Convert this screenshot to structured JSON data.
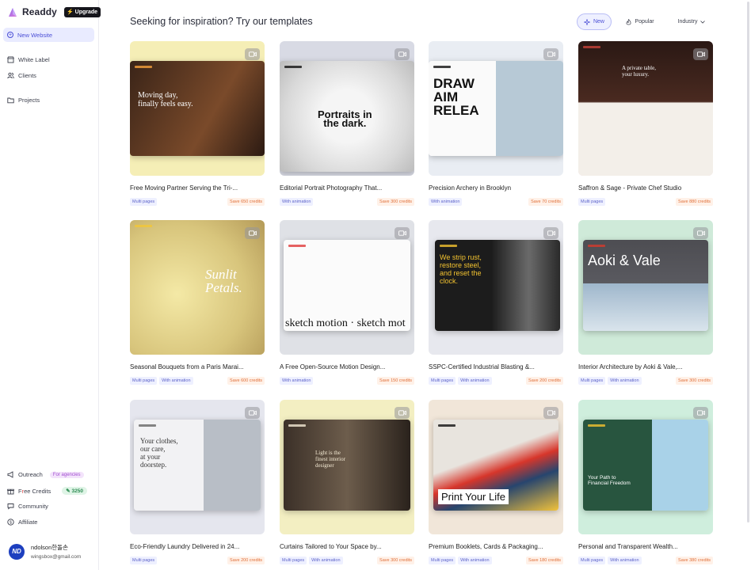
{
  "app": {
    "brand": "Readdy",
    "upgrade_label": "Upgrade"
  },
  "sidebar": {
    "new_website": "New Website",
    "nav": {
      "white_label": "White Label",
      "clients": "Clients",
      "projects": "Projects"
    },
    "bottom": {
      "outreach": "Outreach",
      "outreach_badge": "For agencies",
      "credits_prefix": "F",
      "credits_r": "r",
      "credits_suffix": "ee Credits",
      "credits_value": "3250",
      "community": "Community",
      "affiliate": "Affiliate"
    },
    "user": {
      "initials": "ND",
      "name": "ndolson한돌손",
      "email": "wingsbox@gmail.com"
    }
  },
  "header": {
    "title": "Seeking for inspiration? Try our templates",
    "filters": {
      "new": "New",
      "popular": "Popular",
      "industry": "Industry"
    }
  },
  "templates": [
    {
      "title": "Free Moving Partner Serving the Tri-...",
      "tags": [
        "Multi pages"
      ],
      "credits": "Save 650 credits",
      "bg": "#f5eeb6",
      "screen_text": [
        "Moving day,",
        "finally feels easy."
      ]
    },
    {
      "title": "Editorial Portrait Photography That...",
      "tags": [
        "With animation"
      ],
      "credits": "Save 300 credits",
      "bg": "#d8dae4",
      "screen_text": [
        "Portraits in",
        "the dark."
      ]
    },
    {
      "title": "Precision Archery in Brooklyn",
      "tags": [
        "With animation"
      ],
      "credits": "Save 70 credits",
      "bg": "#e9edf3",
      "screen_text": [
        "DRAW",
        "AIM",
        "RELEA"
      ]
    },
    {
      "title": "Saffron & Sage - Private Chef Studio",
      "tags": [
        "Multi pages"
      ],
      "credits": "Save 880 credits",
      "bg": "#f2d3dc",
      "screen_text": [
        "A private table,",
        "your luxury."
      ]
    },
    {
      "title": "Seasonal Bouquets from a Paris Marai...",
      "tags": [
        "Multi pages",
        "With animation"
      ],
      "credits": "Save 600 credits",
      "bg": "#f7efb8",
      "screen_text": [
        "Sunlit",
        "Petals."
      ]
    },
    {
      "title": "A Free Open-Source Motion Design...",
      "tags": [
        "With animation"
      ],
      "credits": "Save 150 credits",
      "bg": "#dfe1e6",
      "screen_text": [
        "sketch motion · sketch mot"
      ]
    },
    {
      "title": "SSPC-Certified Industrial Blasting &...",
      "tags": [
        "Multi pages",
        "With animation"
      ],
      "credits": "Save 200 credits",
      "bg": "#e7e8ee",
      "screen_text": [
        "We strip rust,",
        "restore steel,",
        "and reset the",
        "clock."
      ]
    },
    {
      "title": "Interior Architecture by Aoki & Vale,...",
      "tags": [
        "Multi pages",
        "With animation"
      ],
      "credits": "Save 300 credits",
      "bg": "#cfead9",
      "screen_text": [
        "Aoki & Vale"
      ]
    },
    {
      "title": "Eco-Friendly Laundry Delivered in 24...",
      "tags": [
        "Multi pages"
      ],
      "credits": "Save 200 credits",
      "bg": "#e5e6ee",
      "screen_text": [
        "Your clothes,",
        "our care,",
        "at your",
        "doorstep."
      ]
    },
    {
      "title": "Curtains Tailored to Your Space by...",
      "tags": [
        "Multi pages",
        "With animation"
      ],
      "credits": "Save 300 credits",
      "bg": "#f3efc2",
      "screen_text": [
        "Light is the",
        "finest interior",
        "designer"
      ]
    },
    {
      "title": "Premium Booklets, Cards & Packaging...",
      "tags": [
        "Multi pages",
        "With animation"
      ],
      "credits": "Save 180 credits",
      "bg": "#f1e6d9",
      "screen_text": [
        "Print Your  Life"
      ]
    },
    {
      "title": "Personal and Transparent Wealth...",
      "tags": [
        "Multi pages",
        "With animation"
      ],
      "credits": "Save 380 credits",
      "bg": "#cfeedd",
      "screen_text": [
        "Your Path to",
        "Financial Freedom"
      ]
    }
  ],
  "colors": {
    "accent": "#4b4fd6",
    "credits_orange": "#e0703a",
    "tag_purple": "#5d63c9"
  }
}
